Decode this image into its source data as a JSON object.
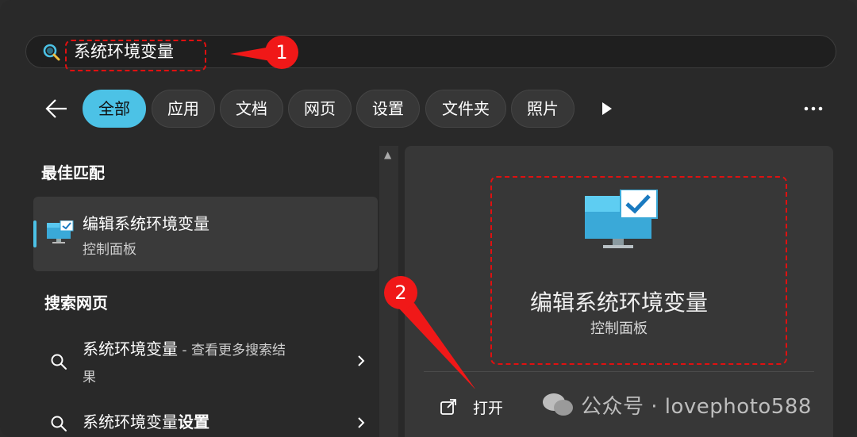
{
  "search": {
    "query": "系统环境变量"
  },
  "annotations": {
    "step1": "1",
    "step2": "2"
  },
  "filters": [
    {
      "label": "全部",
      "active": true
    },
    {
      "label": "应用"
    },
    {
      "label": "文档"
    },
    {
      "label": "网页"
    },
    {
      "label": "设置"
    },
    {
      "label": "文件夹"
    },
    {
      "label": "照片"
    }
  ],
  "left": {
    "best_match_heading": "最佳匹配",
    "best_match": {
      "title": "编辑系统环境变量",
      "subtitle": "控制面板"
    },
    "web_heading": "搜索网页",
    "web_results": [
      {
        "query": "系统环境变量",
        "suffix": " - 查看更多搜索结",
        "suffix2": "果"
      },
      {
        "query": "系统环境变量",
        "bold_part": "设置"
      }
    ]
  },
  "detail": {
    "title": "编辑系统环境变量",
    "subtitle": "控制面板",
    "open_label": "打开"
  },
  "watermark": "公众号 · lovephoto588",
  "colors": {
    "accent": "#4cc2e6",
    "annotation_red": "#e01010"
  }
}
